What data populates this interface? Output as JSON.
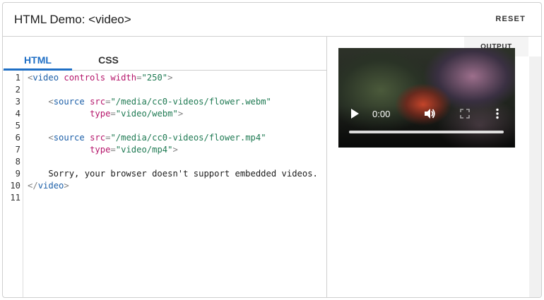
{
  "header": {
    "title": "HTML Demo: <video>",
    "reset_label": "RESET"
  },
  "tabs": [
    {
      "label": "HTML",
      "active": true
    },
    {
      "label": "CSS",
      "active": false
    }
  ],
  "editor": {
    "line_numbers": [
      "1",
      "2",
      "3",
      "4",
      "5",
      "6",
      "7",
      "8",
      "9",
      "10",
      "11"
    ],
    "lines": [
      [
        {
          "t": "punc",
          "v": "<"
        },
        {
          "t": "tag",
          "v": "video"
        },
        {
          "t": "text",
          "v": " "
        },
        {
          "t": "attr",
          "v": "controls"
        },
        {
          "t": "text",
          "v": " "
        },
        {
          "t": "attr",
          "v": "width"
        },
        {
          "t": "punc",
          "v": "="
        },
        {
          "t": "str",
          "v": "\"250\""
        },
        {
          "t": "punc",
          "v": ">"
        }
      ],
      [],
      [
        {
          "t": "text",
          "v": "    "
        },
        {
          "t": "punc",
          "v": "<"
        },
        {
          "t": "tag",
          "v": "source"
        },
        {
          "t": "text",
          "v": " "
        },
        {
          "t": "attr",
          "v": "src"
        },
        {
          "t": "punc",
          "v": "="
        },
        {
          "t": "str",
          "v": "\"/media/cc0-videos/flower.webm\""
        }
      ],
      [
        {
          "t": "text",
          "v": "            "
        },
        {
          "t": "attr",
          "v": "type"
        },
        {
          "t": "punc",
          "v": "="
        },
        {
          "t": "str",
          "v": "\"video/webm\""
        },
        {
          "t": "punc",
          "v": ">"
        }
      ],
      [],
      [
        {
          "t": "text",
          "v": "    "
        },
        {
          "t": "punc",
          "v": "<"
        },
        {
          "t": "tag",
          "v": "source"
        },
        {
          "t": "text",
          "v": " "
        },
        {
          "t": "attr",
          "v": "src"
        },
        {
          "t": "punc",
          "v": "="
        },
        {
          "t": "str",
          "v": "\"/media/cc0-videos/flower.mp4\""
        }
      ],
      [
        {
          "t": "text",
          "v": "            "
        },
        {
          "t": "attr",
          "v": "type"
        },
        {
          "t": "punc",
          "v": "="
        },
        {
          "t": "str",
          "v": "\"video/mp4\""
        },
        {
          "t": "punc",
          "v": ">"
        }
      ],
      [],
      [
        {
          "t": "text",
          "v": "    Sorry, your browser doesn't support embedded videos."
        }
      ],
      [
        {
          "t": "punc",
          "v": "</"
        },
        {
          "t": "tag",
          "v": "video"
        },
        {
          "t": "punc",
          "v": ">"
        }
      ],
      []
    ]
  },
  "output": {
    "label": "OUTPUT",
    "video": {
      "time": "0:00",
      "play_icon": "play-icon",
      "volume_icon": "volume-icon",
      "fullscreen_icon": "fullscreen-icon",
      "more_icon": "more-options-icon",
      "progress": 0
    }
  },
  "colors": {
    "accent": "#1f6fc5",
    "tag": "#1c5fa8",
    "attr": "#b5166b",
    "string": "#1f7a53",
    "punctuation": "#808080"
  }
}
